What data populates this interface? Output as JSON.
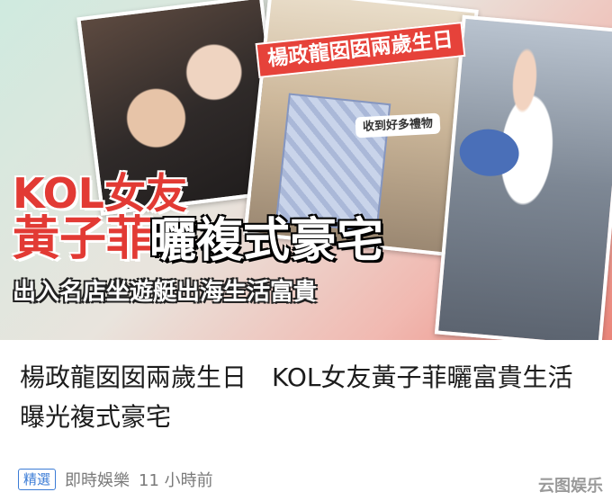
{
  "hero": {
    "banner_top": "楊政龍囡囡兩歲生日",
    "sticker": "收到好多禮物",
    "headline_1": "KOL女友",
    "headline_2": "黃子菲",
    "headline_3": "曬複式豪宅",
    "subline": "出入名店坐遊艇出海生活富貴"
  },
  "article": {
    "title": "楊政龍囡囡兩歲生日　KOL女友黃子菲曬富貴生活曝光複式豪宅"
  },
  "meta": {
    "badge": "精選",
    "source": "即時娛樂",
    "time": "11 小時前"
  },
  "watermark": "云图娱乐",
  "colors": {
    "accent_red": "#e23a34",
    "badge_blue": "#3b7cd6"
  }
}
